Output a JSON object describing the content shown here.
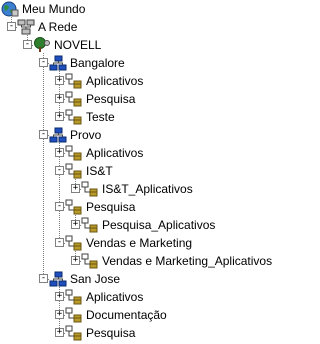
{
  "tree": [
    {
      "label": "Meu Mundo",
      "icon": "globe-icon",
      "level": 0,
      "expander": "none",
      "name": "tree-item-meu-mundo"
    },
    {
      "label": "A Rede",
      "icon": "network-icon",
      "level": 1,
      "expander": "-",
      "name": "tree-item-a-rede"
    },
    {
      "label": "NOVELL",
      "icon": "tree-icon",
      "level": 2,
      "expander": "-",
      "name": "tree-item-novell"
    },
    {
      "label": "Bangalore",
      "icon": "organization-icon",
      "level": 3,
      "expander": "-",
      "name": "tree-item-bangalore"
    },
    {
      "label": "Aplicativos",
      "icon": "org-unit-icon",
      "level": 4,
      "expander": "+",
      "name": "tree-item-bangalore-aplicativos"
    },
    {
      "label": "Pesquisa",
      "icon": "org-unit-icon",
      "level": 4,
      "expander": "+",
      "name": "tree-item-bangalore-pesquisa"
    },
    {
      "label": "Teste",
      "icon": "org-unit-icon",
      "level": 4,
      "expander": "+",
      "name": "tree-item-bangalore-teste"
    },
    {
      "label": "Provo",
      "icon": "organization-icon",
      "level": 3,
      "expander": "-",
      "name": "tree-item-provo"
    },
    {
      "label": "Aplicativos",
      "icon": "org-unit-icon",
      "level": 4,
      "expander": "+",
      "name": "tree-item-provo-aplicativos"
    },
    {
      "label": "IS&T",
      "icon": "org-unit-icon",
      "level": 4,
      "expander": "-",
      "name": "tree-item-provo-ist"
    },
    {
      "label": "IS&T_Aplicativos",
      "icon": "org-unit-icon",
      "level": 5,
      "expander": "+",
      "name": "tree-item-ist-aplicativos"
    },
    {
      "label": "Pesquisa",
      "icon": "org-unit-icon",
      "level": 4,
      "expander": "-",
      "name": "tree-item-provo-pesquisa"
    },
    {
      "label": "Pesquisa_Aplicativos",
      "icon": "org-unit-icon",
      "level": 5,
      "expander": "+",
      "name": "tree-item-pesquisa-aplicativos"
    },
    {
      "label": "Vendas e Marketing",
      "icon": "org-unit-icon",
      "level": 4,
      "expander": "-",
      "name": "tree-item-vendas-e-marketing"
    },
    {
      "label": "Vendas e Marketing_Aplicativos",
      "icon": "org-unit-icon",
      "level": 5,
      "expander": "+",
      "name": "tree-item-vendas-e-marketing-aplicativos"
    },
    {
      "label": "San Jose",
      "icon": "organization-icon",
      "level": 3,
      "expander": "-",
      "name": "tree-item-san-jose"
    },
    {
      "label": "Aplicativos",
      "icon": "org-unit-icon",
      "level": 4,
      "expander": "+",
      "name": "tree-item-san-jose-aplicativos"
    },
    {
      "label": "Documentação",
      "icon": "org-unit-icon",
      "level": 4,
      "expander": "+",
      "name": "tree-item-san-jose-documentacao"
    },
    {
      "label": "Pesquisa",
      "icon": "org-unit-icon",
      "level": 4,
      "expander": "+",
      "name": "tree-item-san-jose-pesquisa"
    }
  ],
  "colors": {
    "line": "#808080",
    "globe": "#2f8f3f",
    "org_blue": "#1f4fbf",
    "ou_gold": "#b89a2a",
    "tree_green": "#2f7f2f"
  }
}
